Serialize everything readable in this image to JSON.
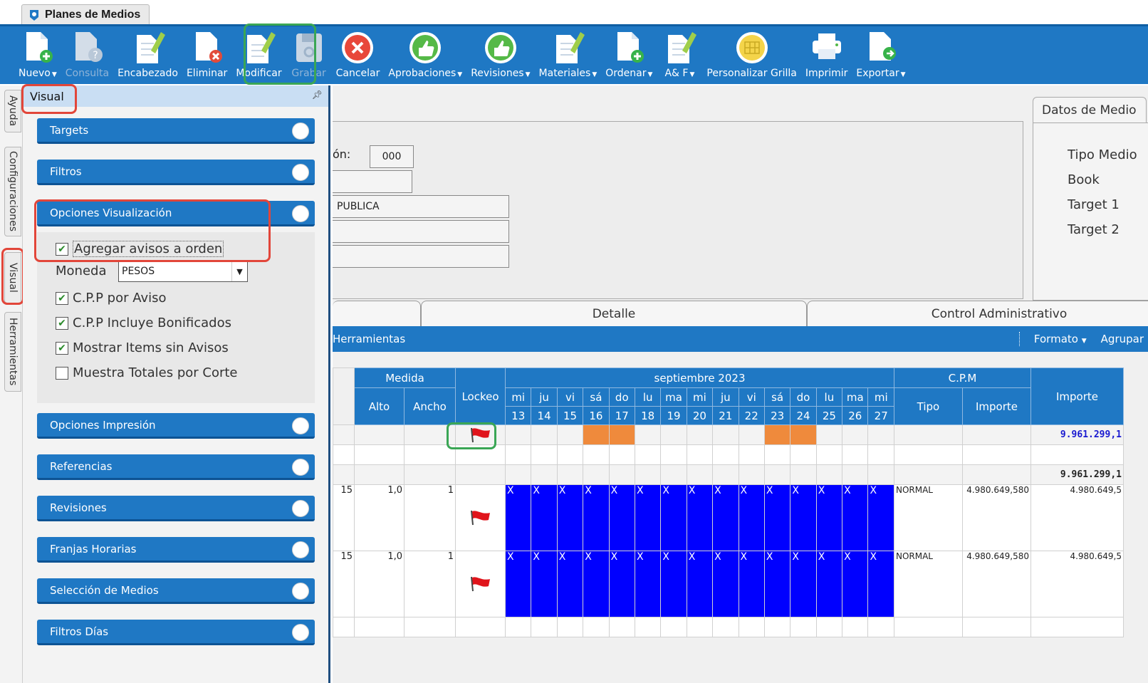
{
  "window": {
    "title": "Planes de Medios"
  },
  "toolbar": {
    "buttons": [
      {
        "label": "Nuevo",
        "icon": "doc-plus-icon",
        "dropdown": true,
        "disabled": false
      },
      {
        "label": "Consulta",
        "icon": "doc-question-icon",
        "dropdown": false,
        "disabled": true
      },
      {
        "label": "Encabezado",
        "icon": "doc-pencil-icon",
        "dropdown": false,
        "disabled": false
      },
      {
        "label": "Eliminar",
        "icon": "doc-delete-icon",
        "dropdown": false,
        "disabled": false
      },
      {
        "label": "Modificar",
        "icon": "doc-edit-icon",
        "dropdown": false,
        "disabled": false
      },
      {
        "label": "Grabar",
        "icon": "save-icon",
        "dropdown": false,
        "disabled": true
      },
      {
        "label": "Cancelar",
        "icon": "cancel-icon",
        "dropdown": false,
        "disabled": false
      },
      {
        "label": "Aprobaciones",
        "icon": "thumbs-up-icon",
        "dropdown": true,
        "disabled": false
      },
      {
        "label": "Revisiones",
        "icon": "thumbs-up-icon",
        "dropdown": true,
        "disabled": false
      },
      {
        "label": "Materiales",
        "icon": "doc-pencil-icon",
        "dropdown": true,
        "disabled": false
      },
      {
        "label": "Ordenar",
        "icon": "doc-plus-icon",
        "dropdown": true,
        "disabled": false
      },
      {
        "label": "A& F",
        "icon": "doc-pencil-icon",
        "dropdown": true,
        "disabled": false
      },
      {
        "label": "Personalizar Grilla",
        "icon": "grid-icon",
        "dropdown": false,
        "disabled": false
      },
      {
        "label": "Imprimir",
        "icon": "printer-icon",
        "dropdown": false,
        "disabled": false
      },
      {
        "label": "Exportar",
        "icon": "export-icon",
        "dropdown": true,
        "disabled": false
      }
    ]
  },
  "vertical_tabs": [
    "Ayuda",
    "Configuraciones",
    "Visual",
    "Herramientas"
  ],
  "panel": {
    "title": "Visual",
    "sections": {
      "targets": "Targets",
      "filtros": "Filtros",
      "opciones_visualizacion": "Opciones Visualización",
      "opciones_impresion": "Opciones Impresión",
      "referencias": "Referencias",
      "revisiones": "Revisiones",
      "franjas_horarias": "Franjas Horarias",
      "seleccion_medios": "Selección de Medios",
      "filtros_dias": "Filtros Días"
    },
    "options": {
      "agregar_avisos": {
        "label": "Agregar avisos a orden",
        "checked": true
      },
      "moneda_label": "Moneda",
      "moneda_value": "PESOS",
      "cpp_aviso": {
        "label": "C.P.P por Aviso",
        "checked": true
      },
      "cpp_bonificados": {
        "label": "C.P.P Incluye Bonificados",
        "checked": true
      },
      "mostrar_items": {
        "label": "Mostrar Items sin Avisos",
        "checked": true
      },
      "muestra_totales": {
        "label": "Muestra Totales por Corte",
        "checked": false
      }
    }
  },
  "form": {
    "label_on": "ón:",
    "code_value": "000",
    "publica_value": "PUBLICA"
  },
  "datos_medio": {
    "tab": "Datos de Medio",
    "labels": [
      "Tipo Medio",
      "Book",
      "Target 1",
      "Target 2"
    ]
  },
  "subtabs": {
    "detalle": "Detalle",
    "control": "Control Administrativo"
  },
  "gridbar": {
    "herramientas": "Herramientas",
    "formato": "Formato",
    "agrupar": "Agrupar"
  },
  "grid": {
    "headers": {
      "medida": "Medida",
      "alto": "Alto",
      "ancho": "Ancho",
      "lockeo": "Lockeo",
      "month": "septiembre 2023",
      "cpm": "C.P.M",
      "tipo": "Tipo",
      "importe_cpm": "Importe",
      "importe": "Importe"
    },
    "days": [
      {
        "dow": "mi",
        "num": "13"
      },
      {
        "dow": "ju",
        "num": "14"
      },
      {
        "dow": "vi",
        "num": "15"
      },
      {
        "dow": "sá",
        "num": "16"
      },
      {
        "dow": "do",
        "num": "17"
      },
      {
        "dow": "lu",
        "num": "18"
      },
      {
        "dow": "ma",
        "num": "19"
      },
      {
        "dow": "mi",
        "num": "20"
      },
      {
        "dow": "ju",
        "num": "21"
      },
      {
        "dow": "vi",
        "num": "22"
      },
      {
        "dow": "sá",
        "num": "23"
      },
      {
        "dow": "do",
        "num": "24"
      },
      {
        "dow": "lu",
        "num": "25"
      },
      {
        "dow": "ma",
        "num": "26"
      },
      {
        "dow": "mi",
        "num": "27"
      }
    ],
    "weekend_highlight": [
      3,
      4,
      10,
      11
    ],
    "total_top": "9.961.299,1",
    "total_mid": "9.961.299,1",
    "rows": [
      {
        "c0": "15",
        "alto": "1,0",
        "ancho": "1",
        "mark": "X",
        "tipo": "NORMAL",
        "cpm_importe": "4.980.649,580",
        "importe": "4.980.649,5"
      },
      {
        "c0": "15",
        "alto": "1,0",
        "ancho": "1",
        "mark": "X",
        "tipo": "NORMAL",
        "cpm_importe": "4.980.649,580",
        "importe": "4.980.649,5"
      }
    ]
  }
}
